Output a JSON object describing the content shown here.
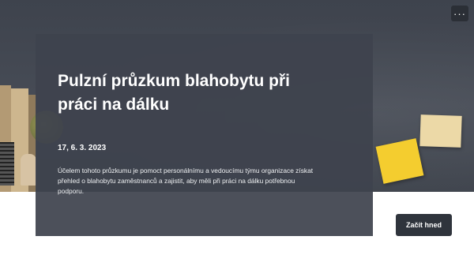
{
  "survey": {
    "title": "Pulzní průzkum blahobytu při práci na dálku",
    "date": "17, 6. 3. 2023",
    "description": "Účelem tohoto průzkumu je pomoct personálnímu a vedoucímu týmu organizace získat přehled o blahobytu zaměstnanců a zajistit, aby měli při práci na dálku potřebnou podporu."
  },
  "actions": {
    "more_label": "···",
    "start_label": "Začít hned"
  },
  "icons": {
    "more": "ellipsis-icon"
  },
  "colors": {
    "hero_background": "#474c56",
    "card_background": "#3e434d",
    "button_background": "#2f343c",
    "accent_note": "#f4cd2f"
  }
}
